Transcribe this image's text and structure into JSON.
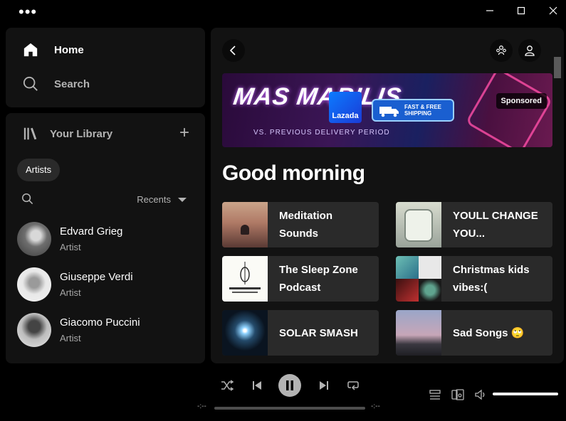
{
  "titlebar": {
    "menu_glyph": "•••"
  },
  "nav": {
    "home_label": "Home",
    "search_label": "Search"
  },
  "library": {
    "title": "Your Library",
    "add_glyph": "+",
    "filter_chip": "Artists",
    "sort_label": "Recents",
    "artists": [
      {
        "name": "Edvard Grieg",
        "type": "Artist"
      },
      {
        "name": "Giuseppe Verdi",
        "type": "Artist"
      },
      {
        "name": "Giacomo Puccini",
        "type": "Artist"
      }
    ]
  },
  "ad": {
    "headline": "MAS MABILIS",
    "tagline": "VS. PREVIOUS DELIVERY PERIOD",
    "brand": "Lazada",
    "shipping": "FAST & FREE SHIPPING",
    "sponsored_label": "Sponsored"
  },
  "main": {
    "greeting": "Good morning",
    "shortcuts": [
      {
        "title": "Meditation Sounds"
      },
      {
        "title": "YOULL CHANGE YOU..."
      },
      {
        "title": "The Sleep Zone Podcast"
      },
      {
        "title": "Christmas kids vibes:("
      },
      {
        "title": "SOLAR SMASH"
      },
      {
        "title": "Sad Songs 🙄"
      }
    ]
  },
  "player": {
    "elapsed": "-:--",
    "remaining": "-:--"
  },
  "colors": {
    "background": "#000000",
    "panel": "#121212",
    "card": "#2a2a2a",
    "text_dim": "#b3b3b3"
  }
}
